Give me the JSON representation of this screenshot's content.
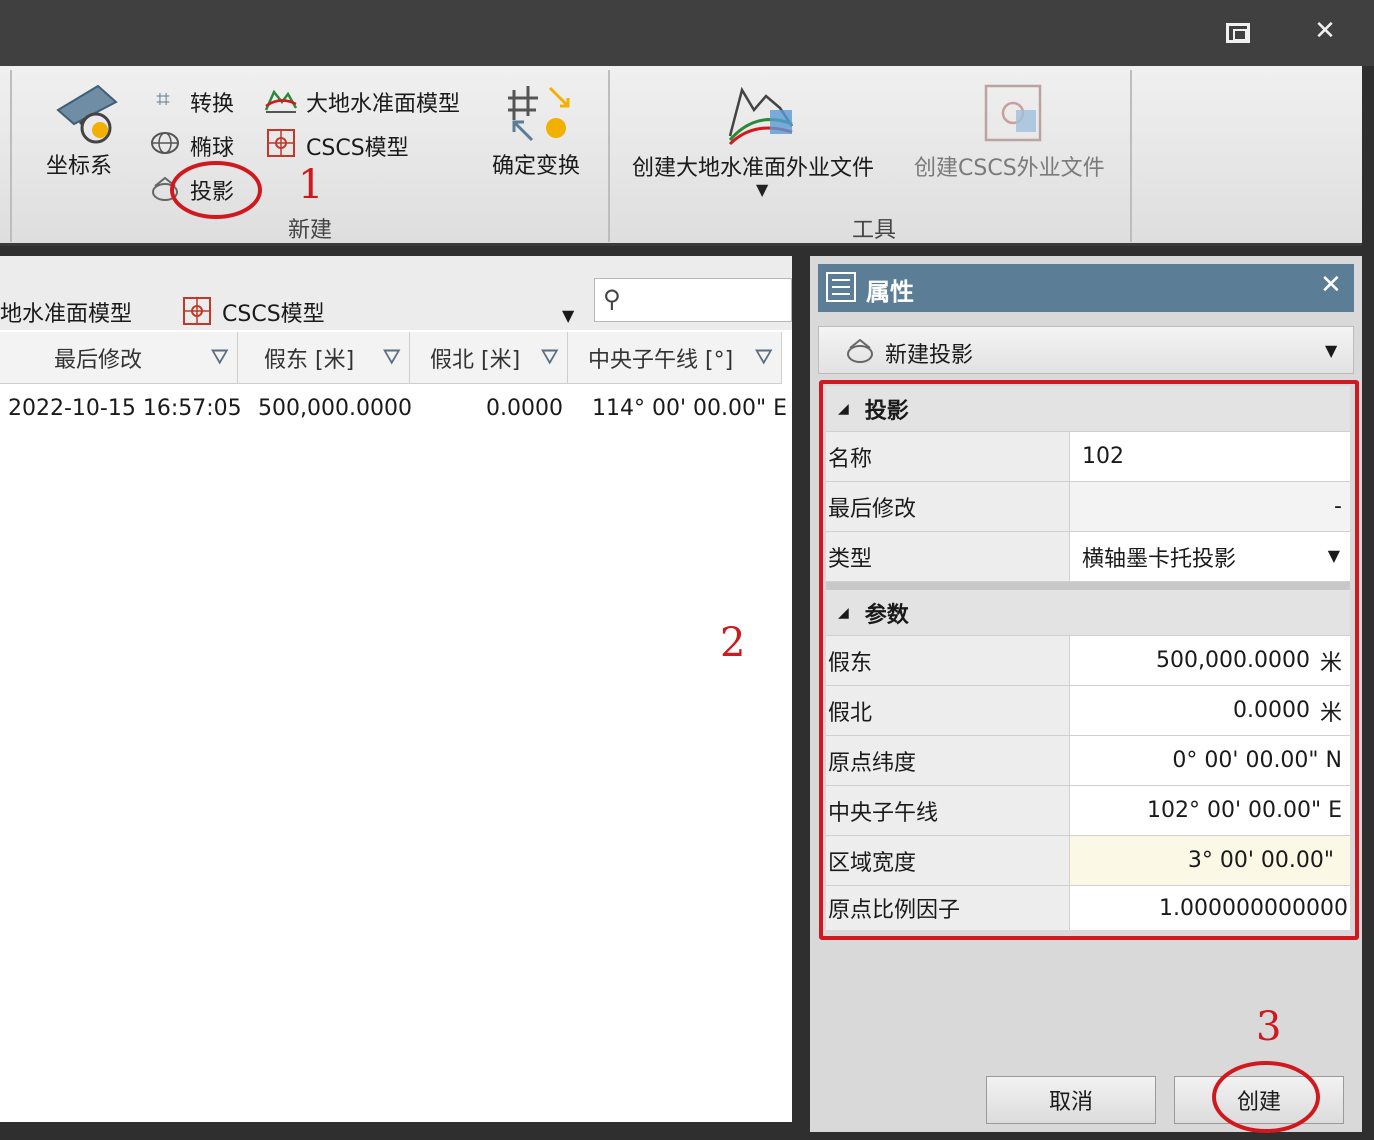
{
  "window": {
    "maximize_glyph": "",
    "close_glyph": "✕"
  },
  "ribbon": {
    "group_new": {
      "label": "新建",
      "coordinate_system": "坐标系",
      "transform": "转换",
      "ellipsoid": "椭球",
      "projection": "投影",
      "geoid_model": "大地水准面模型",
      "cscs_model": "CSCS模型",
      "determine_transform": "确定变换"
    },
    "group_tools": {
      "label": "工具",
      "create_geoid_file": "创建大地水准面外业文件",
      "create_cscs_file": "创建CSCS外业文件"
    }
  },
  "left": {
    "tabs": [
      "地水准面模型",
      "CSCS模型"
    ],
    "search": {
      "placeholder": ""
    },
    "columns": [
      "最后修改",
      "假东 [米]",
      "假北 [米]",
      "中央子午线 [°]"
    ],
    "rows": [
      {
        "modified": "2022-10-15 16:57:05",
        "false_east": "500,000.0000",
        "false_north": "0.0000",
        "central_meridian": "114° 00' 00.00\" E"
      }
    ]
  },
  "properties": {
    "title": "属性",
    "selector": "新建投影",
    "section_projection": "投影",
    "name_label": "名称",
    "name_value": "102",
    "modified_label": "最后修改",
    "modified_value": "-",
    "type_label": "类型",
    "type_value": "横轴墨卡托投影",
    "section_params": "参数",
    "params": [
      {
        "label": "假东",
        "value": "500,000.0000",
        "unit": "米"
      },
      {
        "label": "假北",
        "value": "0.0000",
        "unit": "米"
      },
      {
        "label": "原点纬度",
        "value": "0° 00' 00.00\" N",
        "unit": ""
      },
      {
        "label": "中央子午线",
        "value": "102° 00' 00.00\" E",
        "unit": ""
      },
      {
        "label": "区域宽度",
        "value": "3° 00' 00.00\"",
        "unit": ""
      },
      {
        "label": "原点比例因子",
        "value": "1.000000000000",
        "unit": ""
      }
    ],
    "cancel": "取消",
    "create": "创建"
  },
  "annotations": {
    "a1": "1",
    "a2": "2",
    "a3": "3",
    "color": "#d0191f"
  }
}
